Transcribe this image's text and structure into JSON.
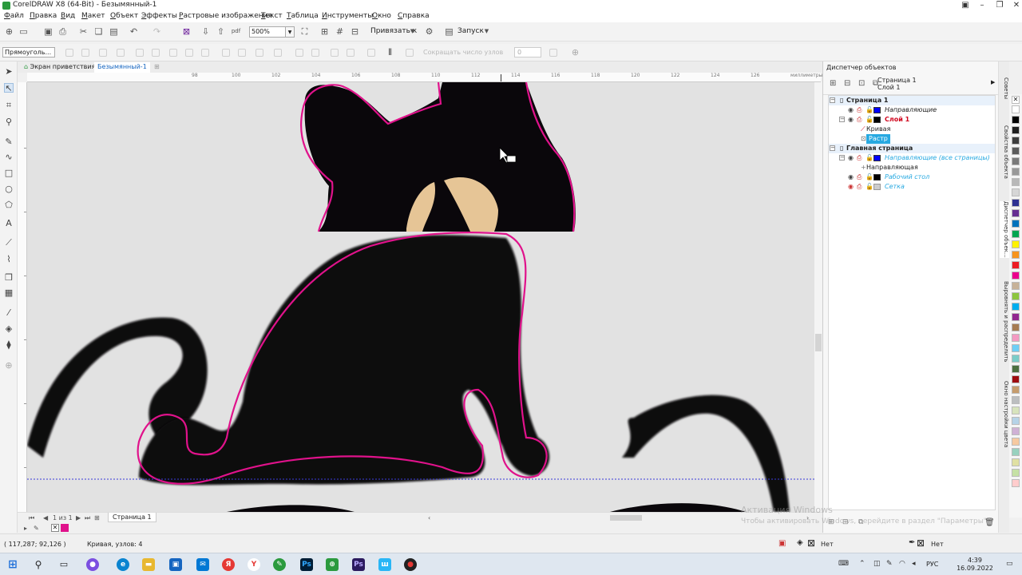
{
  "window": {
    "title": "CorelDRAW X8 (64-Bit) - Безымянный-1",
    "accent": "#2b9a3e"
  },
  "menu": [
    "Файл",
    "Правка",
    "Вид",
    "Макет",
    "Объект",
    "Эффекты",
    "Растровые изображения",
    "Текст",
    "Таблица",
    "Инструменты",
    "Окно",
    "Справка"
  ],
  "toolbar": {
    "zoom": "500%",
    "snap_label": "Привязать к",
    "launch_label": "Запуск"
  },
  "propbar": {
    "shape_mode": "Прямоуголь...",
    "reduce_nodes_label": "Сокращать число узлов",
    "reduce_nodes_value": "0"
  },
  "doc_tabs": {
    "welcome": "Экран приветствия",
    "document": "Безымянный-1"
  },
  "ruler": {
    "top_numbers": [
      "98",
      "100",
      "102",
      "104",
      "106",
      "108",
      "110",
      "112",
      "114",
      "116",
      "118",
      "120",
      "122",
      "124",
      "126",
      "128"
    ],
    "unit": "миллиметры"
  },
  "pagebar": {
    "page_counter": "1 из 1",
    "page_tab": "Страница 1"
  },
  "status": {
    "coords": "( 117,287; 92,126 )",
    "selection": "Кривая, узлов: 4",
    "fill": "Нет",
    "outline": "Нет"
  },
  "docker": {
    "title": "Диспетчер объектов",
    "header_page": "Страница 1",
    "header_layer": "Слой 1",
    "tree": {
      "page1": "Страница 1",
      "guides": "Направляющие",
      "layer1": "Слой 1",
      "curve": "Кривая",
      "raster": "Растр",
      "master": "Главная страница",
      "master_guides": "Направляющие (все страницы)",
      "guide_item": "Направляющая",
      "desktop": "Рабочий стол",
      "grid": "Сетка"
    },
    "colors": {
      "guides": "#0000ff",
      "layer1": "#000000",
      "layer1_text": "#d0021b",
      "selection": "#27a9e1",
      "master_link": "#27a9e1"
    }
  },
  "side_tabs": [
    "Советы",
    "Свойства объекта",
    "Диспетчер объек...",
    "Выровнять и распределить",
    "Окно настройки цвета"
  ],
  "palette": [
    "#ffffff",
    "#000000",
    "#1f1f1f",
    "#3d3d3d",
    "#5b5b5b",
    "#7a7a7a",
    "#999999",
    "#b8b8b8",
    "#d6d6d6",
    "#2e3192",
    "#662d91",
    "#0072bc",
    "#00a651",
    "#fff200",
    "#f7941d",
    "#ed1c24",
    "#ec008c",
    "#c7b299",
    "#8dc63f",
    "#00aeef",
    "#92278f",
    "#a67c52",
    "#f49ac2",
    "#6dcff6",
    "#7accc8",
    "#4c7040",
    "#9e0b0f",
    "#c69c6d",
    "#bcbec0",
    "#d7e3bc",
    "#b5d3e7",
    "#cfb1d5",
    "#f6c9a0",
    "#98d1bf",
    "#e0e0a3",
    "#c5e1a5",
    "#ffcccc"
  ],
  "watermark": {
    "line1": "Активация Windows",
    "line2": "Чтобы активировать Windows, перейдите в раздел \"Параметры\"."
  },
  "taskbar": {
    "time": "4:39",
    "date": "16.09.2022",
    "lang": "РУС"
  },
  "canvas": {
    "selection_color": "#e0128b",
    "cat_fill": "#0a070b",
    "ear_color": "#e6c596",
    "guide_color": "#3b3bd9"
  }
}
